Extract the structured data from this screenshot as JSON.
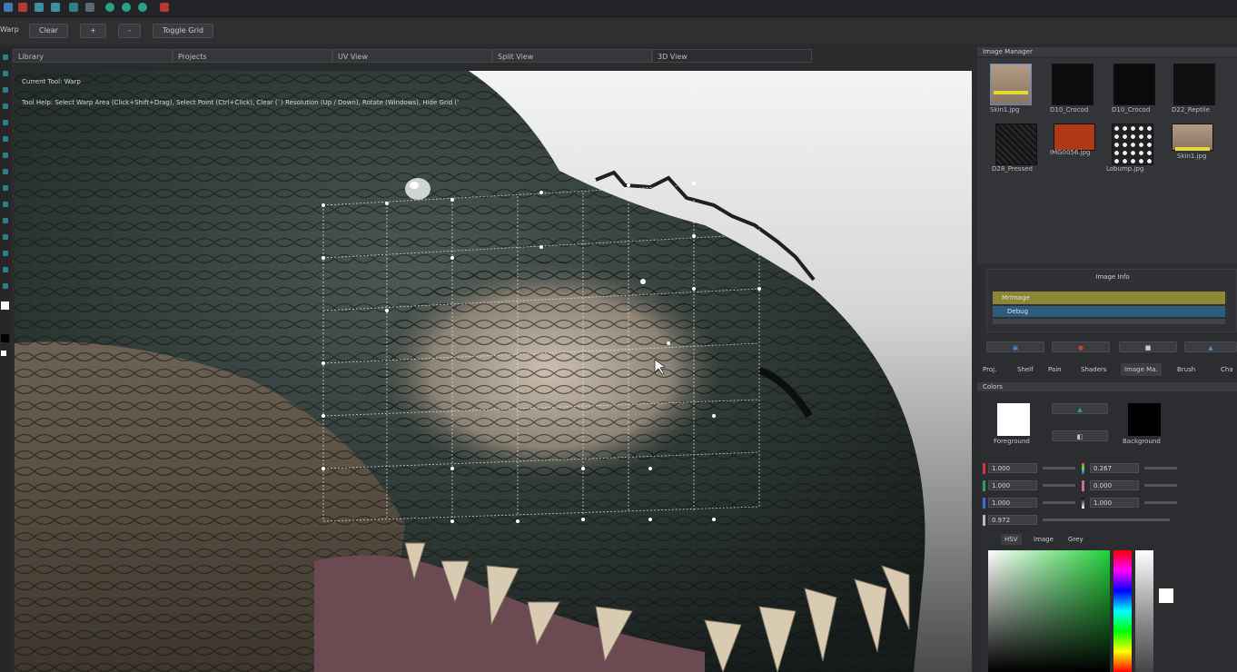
{
  "toolbar": {
    "tool_name": "Warp",
    "clear_label": "Clear",
    "plus_label": "+",
    "minus_label": "-",
    "toggle_grid_label": "Toggle Grid"
  },
  "view_tabs": [
    "Library",
    "Projects",
    "UV View",
    "Split View",
    "3D View"
  ],
  "viewport": {
    "current_tool": "Current Tool: Warp",
    "tool_help": "Tool Help: Select Warp Area (Click+Shift+Drag), Select Point (Ctrl+Click), Clear (`) Resolution (Up / Down), Rotate (Windows), Hide Grid ('"
  },
  "image_manager": {
    "title": "Image Manager",
    "thumbs": [
      {
        "label": "Skin1.jpg",
        "color": "#b39a84"
      },
      {
        "label": "D10_Crocod",
        "color": "#0c0c0c"
      },
      {
        "label": "D10_Crocod",
        "color": "#0a0a0a"
      },
      {
        "label": "D22_Reptile",
        "color": "#101010"
      },
      {
        "label": "D28_Pressed",
        "color": "#151515"
      },
      {
        "label": "IMG0056.jpg",
        "color": "#b03818"
      },
      {
        "label": "Lobump.jpg",
        "color": "#d8d8d8"
      },
      {
        "label": "Skin1.jpg",
        "color": "#b39a84"
      }
    ]
  },
  "image_info": {
    "title": "Image Info",
    "row1": "MrImage",
    "row2": "Debug"
  },
  "panel_tabs": [
    "Proj.",
    "Shelf",
    "Pain",
    "Shaders",
    "Image Ma.",
    "Brush",
    "Cha"
  ],
  "colors": {
    "title": "Colors",
    "foreground_label": "Foreground",
    "background_label": "Background",
    "fields_left": [
      "1.000",
      "1.000",
      "1.000",
      "0.972"
    ],
    "fields_right": [
      "0.267",
      "0.000",
      "1.000"
    ],
    "tabs": [
      "HSV",
      "Image",
      "Grey"
    ]
  }
}
